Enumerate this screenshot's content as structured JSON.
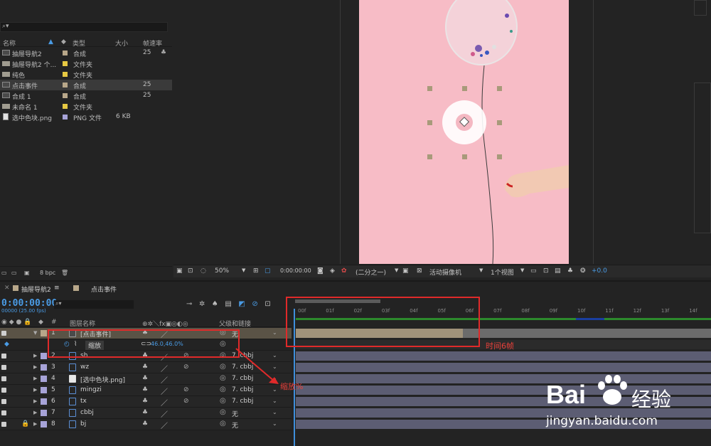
{
  "project": {
    "headers": {
      "name": "名称",
      "type": "类型",
      "size": "大小",
      "fps": "帧速率"
    },
    "items": [
      {
        "name": "抽屉导航2",
        "type": "合成",
        "size": "",
        "fps": "25",
        "label": "#b8a78a",
        "icon": "comp-icon"
      },
      {
        "name": "抽屉导航2 个...",
        "type": "文件夹",
        "size": "",
        "fps": "",
        "label": "#e6c842",
        "icon": "folder-icon"
      },
      {
        "name": "纯色",
        "type": "文件夹",
        "size": "",
        "fps": "",
        "label": "#e6c842",
        "icon": "folder-icon"
      },
      {
        "name": "点击事件",
        "type": "合成",
        "size": "",
        "fps": "25",
        "label": "#b8a78a",
        "icon": "comp-icon"
      },
      {
        "name": "合成 1",
        "type": "合成",
        "size": "",
        "fps": "25",
        "label": "#b8a78a",
        "icon": "comp-icon"
      },
      {
        "name": "未命名 1",
        "type": "文件夹",
        "size": "",
        "fps": "",
        "label": "#e6c842",
        "icon": "folder-icon"
      },
      {
        "name": "选中色块.png",
        "type": "PNG 文件",
        "size": "6 KB",
        "fps": "",
        "label": "#a7a3d8",
        "icon": "file-icon"
      }
    ],
    "footer": {
      "bpc": "8 bpc"
    }
  },
  "viewer": {
    "zoom": "50%",
    "timecode": "0:00:00:00",
    "resolution": "(二分之一)",
    "camera": "活动摄像机",
    "views": "1个视图",
    "exposure": "+0.0"
  },
  "timeline": {
    "tabs": [
      "抽屉导航2",
      "点击事件"
    ],
    "tab_menu": "≡",
    "timecode": "0:00:00:00",
    "fps": "00000 (25.00 fps)",
    "headers": {
      "num": "#",
      "name": "图层名称",
      "parent": "父级和链接"
    },
    "ruler": [
      "00f",
      "01f",
      "02f",
      "03f",
      "04f",
      "05f",
      "06f",
      "07f",
      "08f",
      "09f",
      "10f",
      "11f",
      "12f",
      "13f",
      "14f"
    ],
    "layers": [
      {
        "num": "1",
        "name": "[点击事件]",
        "parent": "无",
        "label": "#b8a78a",
        "type": "comp",
        "expanded": true
      },
      {
        "num": "",
        "name": "缩放",
        "parent": "",
        "label": "",
        "type": "prop",
        "value": "46.0,46.0%"
      },
      {
        "num": "2",
        "name": "sh",
        "parent": "7. cbbj",
        "label": "#a7a3d8",
        "type": "ai"
      },
      {
        "num": "3",
        "name": "wz",
        "parent": "7. cbbj",
        "label": "#a7a3d8",
        "type": "ai"
      },
      {
        "num": "4",
        "name": "[选中色块.png]",
        "parent": "7. cbbj",
        "label": "#a7a3d8",
        "type": "png"
      },
      {
        "num": "5",
        "name": "mingzi",
        "parent": "7. cbbj",
        "label": "#a7a3d8",
        "type": "ai"
      },
      {
        "num": "6",
        "name": "tx",
        "parent": "7. cbbj",
        "label": "#a7a3d8",
        "type": "ai"
      },
      {
        "num": "7",
        "name": "cbbj",
        "parent": "无",
        "label": "#a7a3d8",
        "type": "ai"
      },
      {
        "num": "8",
        "name": "bj",
        "parent": "无",
        "label": "#a7a3d8",
        "type": "ai"
      }
    ]
  },
  "annotations": {
    "scale_note": "缩放%",
    "time_note": "时间6帧"
  },
  "watermark": {
    "brand": "Bai",
    "brand2": "经验",
    "url": "jingyan.baidu.com"
  }
}
